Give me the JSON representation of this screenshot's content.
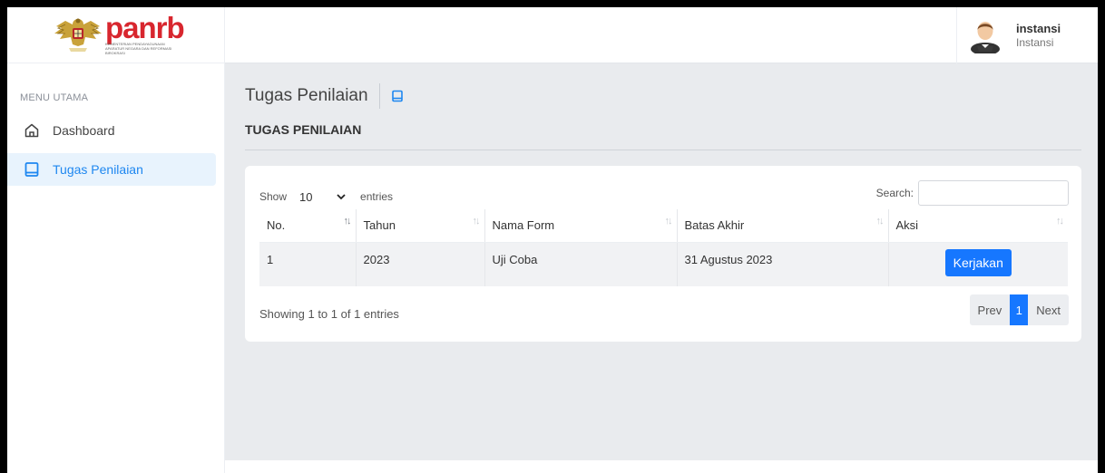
{
  "brand": {
    "name": "panrb",
    "subtitle": "KEMENTERIAN PENDAYAGUNAAN APARATUR NEGARA DAN REFORMASI BIROKRASI"
  },
  "user": {
    "name": "instansi",
    "role": "Instansi"
  },
  "sidebar": {
    "heading": "MENU UTAMA",
    "items": [
      {
        "label": "Dashboard",
        "icon": "home-icon",
        "active": false
      },
      {
        "label": "Tugas Penilaian",
        "icon": "book-icon",
        "active": true
      }
    ]
  },
  "page": {
    "title": "Tugas Penilaian",
    "subtitle": "TUGAS PENILAIAN"
  },
  "table": {
    "show_label": "Show",
    "entries_value": "10",
    "entries_label": "entries",
    "search_label": "Search:",
    "search_value": "",
    "columns": [
      "No.",
      "Tahun",
      "Nama Form",
      "Batas Akhir",
      "Aksi"
    ],
    "rows": [
      {
        "no": "1",
        "tahun": "2023",
        "nama_form": "Uji Coba",
        "batas_akhir": "31 Agustus 2023",
        "action": "Kerjakan"
      }
    ],
    "info": "Showing 1 to 1 of 1 entries",
    "pagination": {
      "prev": "Prev",
      "current": "1",
      "next": "Next"
    }
  },
  "colors": {
    "accent": "#1677ff",
    "brand_red": "#d8262e",
    "active_bg": "#e8f3fd"
  }
}
